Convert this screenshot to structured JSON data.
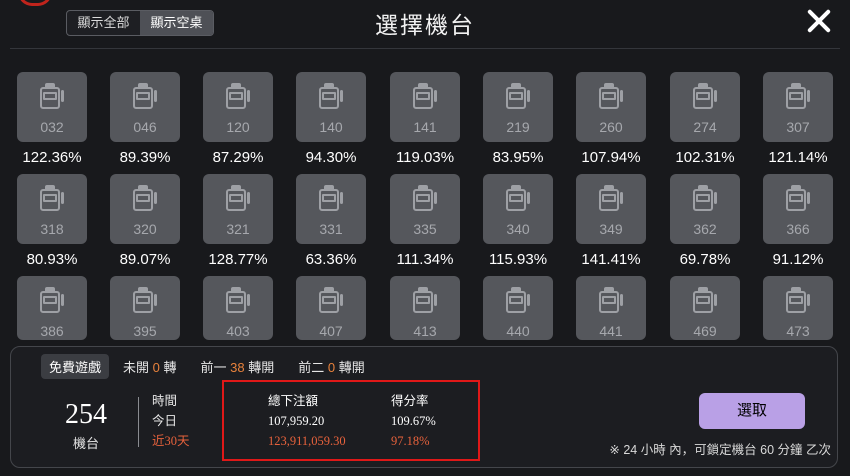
{
  "header": {
    "toggle": {
      "show_all": "顯示全部",
      "show_empty": "顯示空桌"
    },
    "title": "選擇機台"
  },
  "machines": [
    [
      {
        "id": "032",
        "rate": "122.36%"
      },
      {
        "id": "046",
        "rate": "89.39%"
      },
      {
        "id": "120",
        "rate": "87.29%"
      },
      {
        "id": "140",
        "rate": "94.30%"
      },
      {
        "id": "141",
        "rate": "119.03%"
      },
      {
        "id": "219",
        "rate": "83.95%"
      },
      {
        "id": "260",
        "rate": "107.94%"
      },
      {
        "id": "274",
        "rate": "102.31%"
      },
      {
        "id": "307",
        "rate": "121.14%"
      }
    ],
    [
      {
        "id": "318",
        "rate": "80.93%"
      },
      {
        "id": "320",
        "rate": "89.07%"
      },
      {
        "id": "321",
        "rate": "128.77%"
      },
      {
        "id": "331",
        "rate": "63.36%"
      },
      {
        "id": "335",
        "rate": "111.34%"
      },
      {
        "id": "340",
        "rate": "115.93%"
      },
      {
        "id": "349",
        "rate": "141.41%"
      },
      {
        "id": "362",
        "rate": "69.78%"
      },
      {
        "id": "366",
        "rate": "91.12%"
      }
    ],
    [
      {
        "id": "386"
      },
      {
        "id": "395"
      },
      {
        "id": "403"
      },
      {
        "id": "407"
      },
      {
        "id": "413"
      },
      {
        "id": "440"
      },
      {
        "id": "441"
      },
      {
        "id": "469"
      },
      {
        "id": "473"
      }
    ]
  ],
  "detail": {
    "free_game": "免費遊戲",
    "not_open_label": "未開",
    "not_open_value": "0",
    "not_open_unit": "轉",
    "prev1_label": "前一",
    "prev1_value": "38",
    "prev1_unit": "轉開",
    "prev2_label": "前二",
    "prev2_value": "0",
    "prev2_unit": "轉開",
    "machine_number": "254",
    "machine_label": "機台",
    "col_time": "時間",
    "col_bet": "總下注額",
    "col_rate": "得分率",
    "today_label": "今日",
    "today_bet": "107,959.20",
    "today_rate": "109.67%",
    "month_label": "近30天",
    "month_bet": "123,911,059.30",
    "month_rate": "97.18%",
    "select_button": "選取",
    "note": "※ 24 小時 內，可鎖定機台 60 分鐘 乙次"
  },
  "colors": {
    "accent_button": "#b9a0e6",
    "highlight": "#e8623c",
    "annotation_box": "#e01818"
  }
}
